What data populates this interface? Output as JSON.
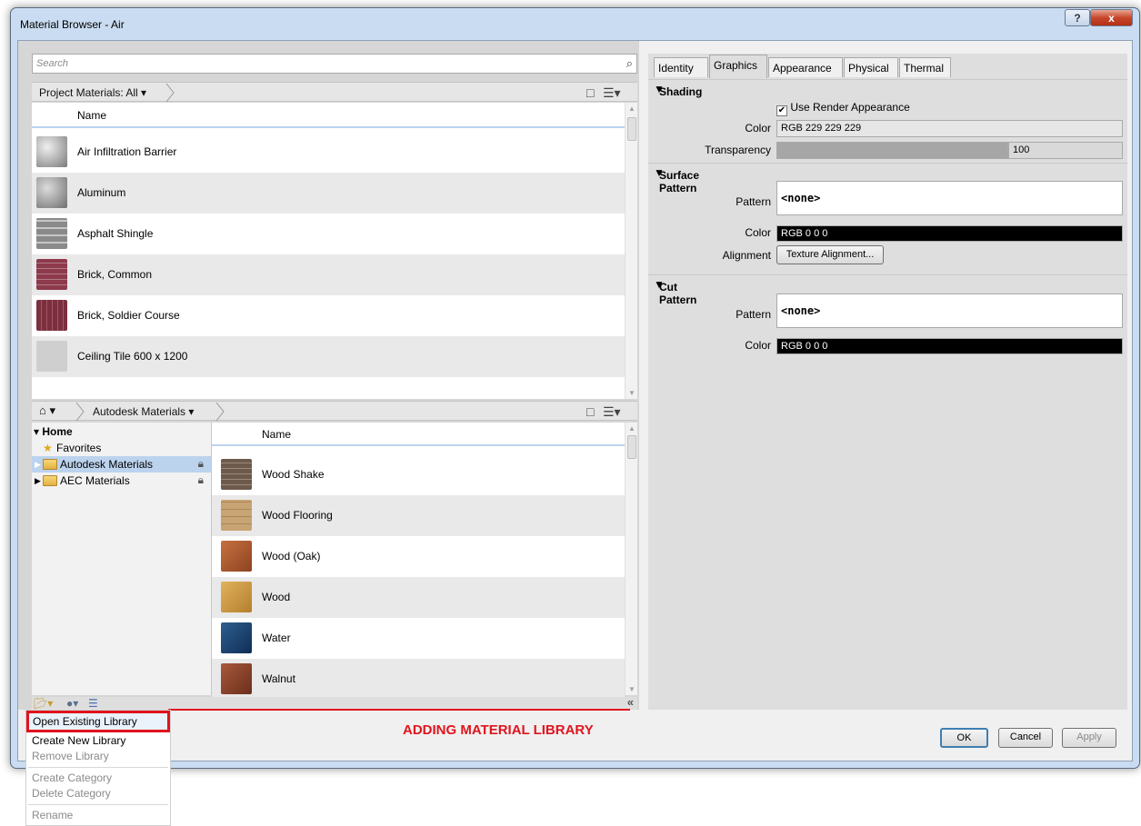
{
  "window": {
    "title": "Material Browser - Air",
    "help_glyph": "?",
    "close_glyph": "x"
  },
  "search": {
    "placeholder": "Search"
  },
  "project": {
    "crumb": "Project Materials: All",
    "column": "Name",
    "items": [
      {
        "label": "Air Infiltration Barrier"
      },
      {
        "label": "Aluminum"
      },
      {
        "label": "Asphalt Shingle"
      },
      {
        "label": "Brick, Common"
      },
      {
        "label": "Brick, Soldier Course"
      },
      {
        "label": "Ceiling Tile 600 x 1200"
      }
    ]
  },
  "library": {
    "crumb": "Autodesk Materials",
    "tree": {
      "home": "Home",
      "favorites": "Favorites",
      "autodesk": "Autodesk Materials",
      "aec": "AEC Materials"
    },
    "column": "Name",
    "items": [
      {
        "label": "Wood Shake"
      },
      {
        "label": "Wood Flooring"
      },
      {
        "label": "Wood (Oak)"
      },
      {
        "label": "Wood"
      },
      {
        "label": "Water"
      },
      {
        "label": "Walnut"
      }
    ]
  },
  "tabs": [
    "Identity",
    "Graphics",
    "Appearance",
    "Physical",
    "Thermal"
  ],
  "shading": {
    "header": "Shading",
    "use_render": "Use Render Appearance",
    "color_label": "Color",
    "color_value": "RGB 229 229 229",
    "transparency_label": "Transparency",
    "transparency_value": "100"
  },
  "surface": {
    "header": "Surface Pattern",
    "pattern_label": "Pattern",
    "pattern_value": "<none>",
    "color_label": "Color",
    "color_value": "RGB 0 0 0",
    "alignment_label": "Alignment",
    "alignment_button": "Texture Alignment..."
  },
  "cut": {
    "header": "Cut Pattern",
    "pattern_label": "Pattern",
    "pattern_value": "<none>",
    "color_label": "Color",
    "color_value": "RGB 0 0 0"
  },
  "buttons": {
    "ok": "OK",
    "cancel": "Cancel",
    "apply": "Apply"
  },
  "menu": {
    "open": "Open Existing Library",
    "create": "Create New Library",
    "remove": "Remove Library",
    "create_cat": "Create Category",
    "delete_cat": "Delete Category",
    "rename": "Rename"
  },
  "annotation": "ADDING MATERIAL LIBRARY",
  "colors": {
    "accent": "#bcd3ee",
    "annotation": "#e0141e"
  },
  "icons": [
    "search-icon",
    "home-icon",
    "star-icon",
    "folder-icon",
    "lock-icon",
    "checkbox-icon",
    "collapse-icon"
  ]
}
